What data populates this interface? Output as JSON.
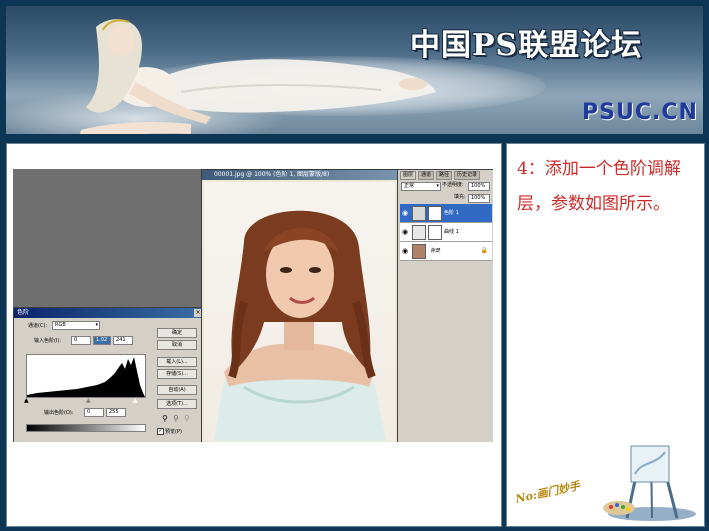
{
  "banner": {
    "title": "中国PS联盟论坛",
    "domain": "PSUC.CN"
  },
  "step": {
    "text": "4：添加一个色阶调解层，参数如图所示。"
  },
  "levels_dialog": {
    "title": "色阶",
    "channel_label": "通道(C):",
    "channel_value": "RGB",
    "input_label": "输入色阶(I):",
    "input_black": "0",
    "input_gamma": "1.02",
    "input_white": "241",
    "output_label": "输出色阶(O):",
    "output_black": "0",
    "output_white": "255",
    "buttons": [
      "确定",
      "取消",
      "载入(L)...",
      "存储(S)...",
      "自动(A)",
      "选项(T)..."
    ],
    "preview_label": "预览(P)"
  },
  "document": {
    "title": "00001.jpg @ 100% (色阶 1, 图层蒙版/8)"
  },
  "layers_panel": {
    "tabs": [
      "图层",
      "通道",
      "路径",
      "历史记录"
    ],
    "blend_mode": "正常",
    "opacity_label": "不透明度:",
    "opacity_value": "100%",
    "fill_label": "填充:",
    "fill_value": "100%",
    "layers": [
      {
        "name": "色阶 1",
        "active": true
      },
      {
        "name": "曲线 1",
        "active": false
      },
      {
        "name": "背景",
        "active": false
      }
    ]
  },
  "decor": {
    "stamp": "No:画门妙手"
  },
  "colors": {
    "frame": "#0c3654",
    "step_text": "#cc2a2a",
    "domain_text": "#1f3a9a"
  }
}
